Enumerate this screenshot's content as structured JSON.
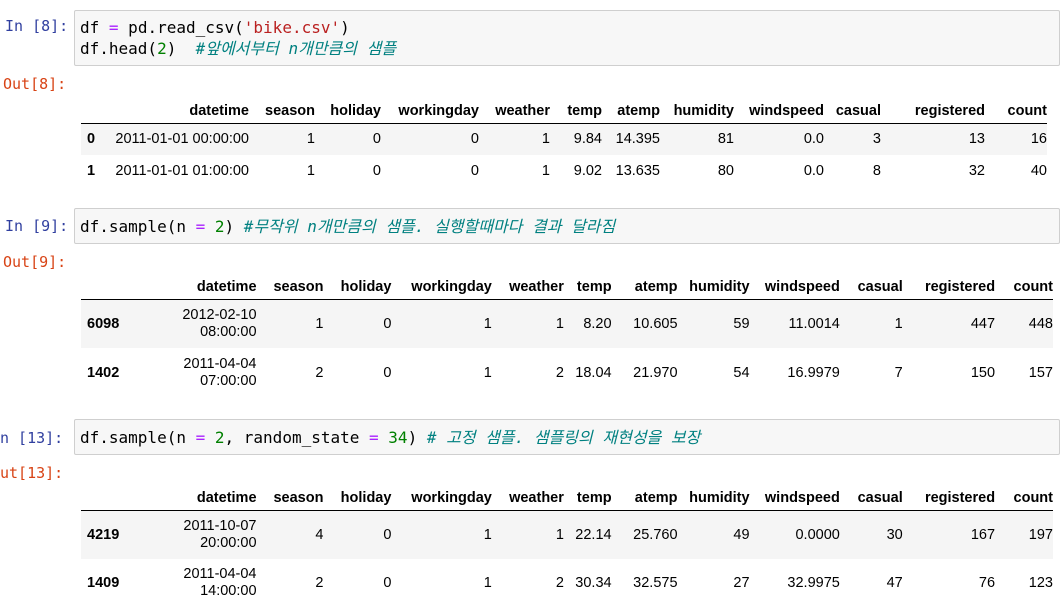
{
  "cells": [
    {
      "in_prompt": "In [8]:",
      "out_prompt": "Out[8]:",
      "code_line1": [
        "df ",
        "=",
        " pd.read_csv(",
        "'bike.csv'",
        ")"
      ],
      "code_line2": [
        "df.head(",
        "2",
        ")  ",
        "#앞에서부터 n개만큼의 샘플"
      ],
      "columns": [
        "datetime",
        "season",
        "holiday",
        "workingday",
        "weather",
        "temp",
        "atemp",
        "humidity",
        "windspeed",
        "casual",
        "registered",
        "count"
      ],
      "rows": [
        {
          "index": "0",
          "datetime": "2011-01-01 00:00:00",
          "season": "1",
          "holiday": "0",
          "workingday": "0",
          "weather": "1",
          "temp": "9.84",
          "atemp": "14.395",
          "humidity": "81",
          "windspeed": "0.0",
          "casual": "3",
          "registered": "13",
          "count": "16"
        },
        {
          "index": "1",
          "datetime": "2011-01-01 01:00:00",
          "season": "1",
          "holiday": "0",
          "workingday": "0",
          "weather": "1",
          "temp": "9.02",
          "atemp": "13.635",
          "humidity": "80",
          "windspeed": "0.0",
          "casual": "8",
          "registered": "32",
          "count": "40"
        }
      ]
    },
    {
      "in_prompt": "In [9]:",
      "out_prompt": "Out[9]:",
      "code_line1": [
        "df.sample(n ",
        "=",
        " ",
        "2",
        ") ",
        "#무작위 n개만큼의 샘플. 실행할때마다 결과 달라짐"
      ],
      "columns": [
        "datetime",
        "season",
        "holiday",
        "workingday",
        "weather",
        "temp",
        "atemp",
        "humidity",
        "windspeed",
        "casual",
        "registered",
        "count"
      ],
      "rows": [
        {
          "index": "6098",
          "date": "2012-02-10",
          "time": "08:00:00",
          "season": "1",
          "holiday": "0",
          "workingday": "1",
          "weather": "1",
          "temp": "8.20",
          "atemp": "10.605",
          "humidity": "59",
          "windspeed": "11.0014",
          "casual": "1",
          "registered": "447",
          "count": "448"
        },
        {
          "index": "1402",
          "date": "2011-04-04",
          "time": "07:00:00",
          "season": "2",
          "holiday": "0",
          "workingday": "1",
          "weather": "2",
          "temp": "18.04",
          "atemp": "21.970",
          "humidity": "54",
          "windspeed": "16.9979",
          "casual": "7",
          "registered": "150",
          "count": "157"
        }
      ]
    },
    {
      "in_prompt": "n [13]:",
      "out_prompt": "ut[13]:",
      "code_line1": [
        "df.sample(n ",
        "=",
        " ",
        "2",
        ", random_state ",
        "=",
        " ",
        "34",
        ") ",
        "# 고정 샘플. 샘플링의 재현성을 보장"
      ],
      "columns": [
        "datetime",
        "season",
        "holiday",
        "workingday",
        "weather",
        "temp",
        "atemp",
        "humidity",
        "windspeed",
        "casual",
        "registered",
        "count"
      ],
      "rows": [
        {
          "index": "4219",
          "date": "2011-10-07",
          "time": "20:00:00",
          "season": "4",
          "holiday": "0",
          "workingday": "1",
          "weather": "1",
          "temp": "22.14",
          "atemp": "25.760",
          "humidity": "49",
          "windspeed": "0.0000",
          "casual": "30",
          "registered": "167",
          "count": "197"
        },
        {
          "index": "1409",
          "date": "2011-04-04",
          "time": "14:00:00",
          "season": "2",
          "holiday": "0",
          "workingday": "1",
          "weather": "2",
          "temp": "30.34",
          "atemp": "32.575",
          "humidity": "27",
          "windspeed": "32.9975",
          "casual": "47",
          "registered": "76",
          "count": "123"
        }
      ]
    }
  ]
}
